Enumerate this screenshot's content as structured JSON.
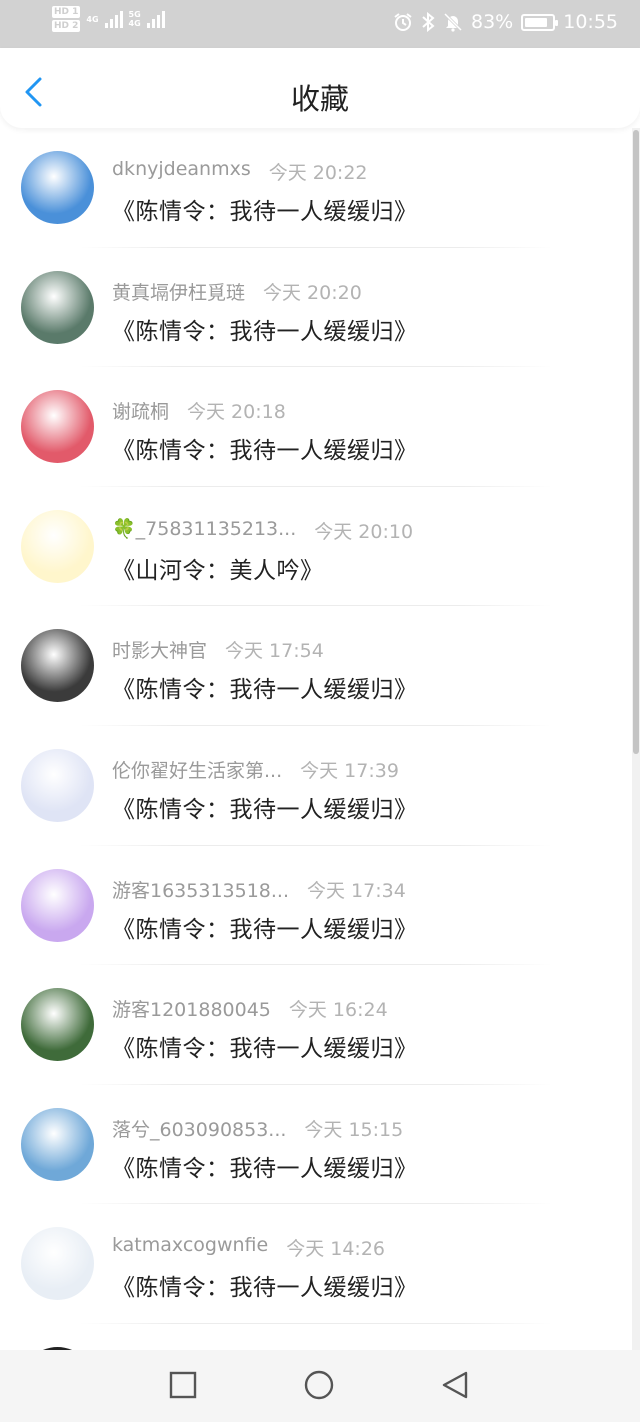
{
  "status_bar": {
    "hd1": "HD 1",
    "hd2": "HD 2",
    "net1": "4G",
    "net2": "5G",
    "net2_sub": "4G",
    "battery": "83%",
    "time": "10:55",
    "battery_level": 0.83,
    "icons": [
      "alarm-icon",
      "bluetooth-icon",
      "mute-bell-icon"
    ]
  },
  "header": {
    "title": "收藏",
    "back_icon": "chevron-left-icon",
    "accent": "#2196f3"
  },
  "items": [
    {
      "user": "dknyjdeanmxs",
      "time": "今天 20:22",
      "book": "《陈情令：我待一人缓缓归》",
      "avatar_color": "#4a90d9"
    },
    {
      "user": "黄真塥伊枉覓琏",
      "time": "今天 20:20",
      "book": "《陈情令：我待一人缓缓归》",
      "avatar_color": "#5a7a6a"
    },
    {
      "user": "谢疏桐",
      "time": "今天 20:18",
      "book": "《陈情令：我待一人缓缓归》",
      "avatar_color": "#e25a6a"
    },
    {
      "user": "🍀_75831135213...",
      "time": "今天 20:10",
      "book": "《山河令：美人吟》",
      "avatar_color": "#fff6cc"
    },
    {
      "user": "时影大神官",
      "time": "今天 17:54",
      "book": "《陈情令：我待一人缓缓归》",
      "avatar_color": "#3b3b3b"
    },
    {
      "user": "伦你翟好生活家第...",
      "time": "今天 17:39",
      "book": "《陈情令：我待一人缓缓归》",
      "avatar_color": "#dfe4f5"
    },
    {
      "user": "游客1635313518...",
      "time": "今天 17:34",
      "book": "《陈情令：我待一人缓缓归》",
      "avatar_color": "#c9a8ef"
    },
    {
      "user": "游客1201880045",
      "time": "今天 16:24",
      "book": "《陈情令：我待一人缓缓归》",
      "avatar_color": "#3f6b3a"
    },
    {
      "user": "落兮_603090853...",
      "time": "今天 15:15",
      "book": "《陈情令：我待一人缓缓归》",
      "avatar_color": "#6fa8d8"
    },
    {
      "user": "katmaxcogwnfie",
      "time": "今天 14:26",
      "book": "《陈情令：我待一人缓缓归》",
      "avatar_color": "#e8eef5"
    }
  ],
  "nav_bar": {
    "recent_icon": "square-icon",
    "home_icon": "circle-icon",
    "back_icon": "triangle-back-icon"
  }
}
